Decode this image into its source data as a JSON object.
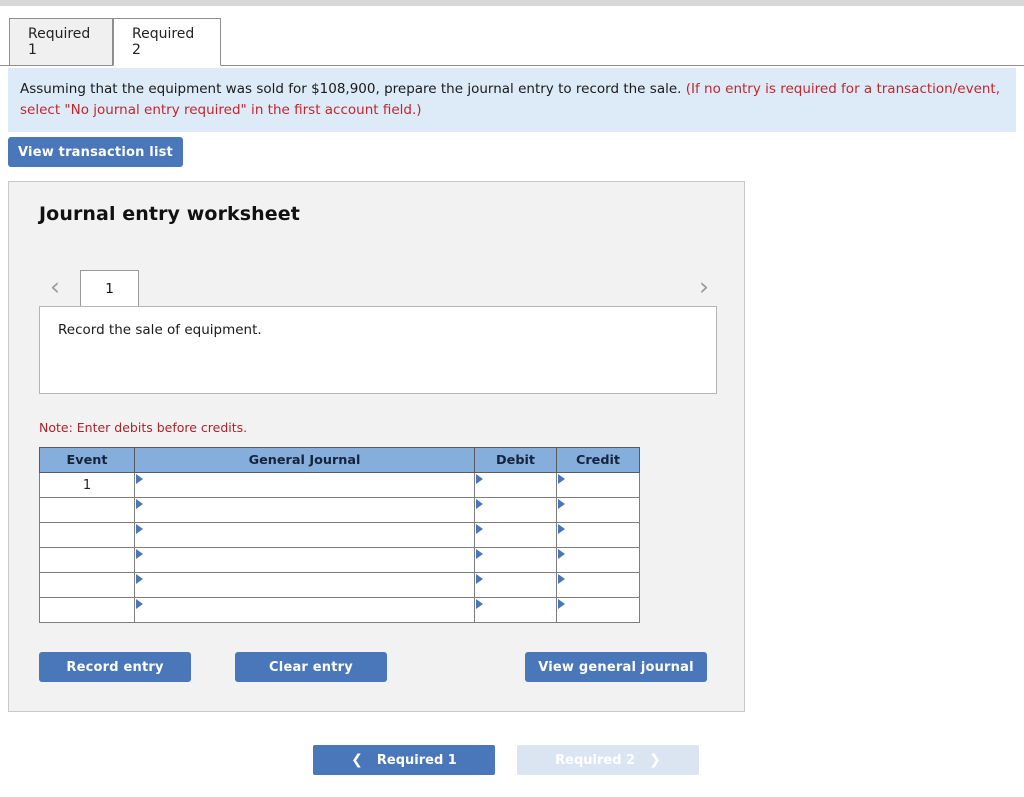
{
  "tabs": [
    {
      "label": "Required 1",
      "active": false
    },
    {
      "label": "Required 2",
      "active": true
    }
  ],
  "instructions": {
    "black_part": "Assuming that the equipment was sold for $108,900, prepare the journal entry to record the sale. ",
    "red_part": "(If no entry is required for a transaction/event, select \"No journal entry required\" in the first account field.)"
  },
  "toolbar": {
    "view_transaction_list_label": "View transaction list"
  },
  "worksheet": {
    "title": "Journal entry worksheet",
    "pager": {
      "prev_icon": "chevron-left-icon",
      "next_icon": "chevron-right-icon",
      "current_entry": "1"
    },
    "transaction_description": "Record the sale of equipment.",
    "note": "Note: Enter debits before credits.",
    "table": {
      "headers": [
        "Event",
        "General Journal",
        "Debit",
        "Credit"
      ],
      "rows": [
        {
          "event": "1",
          "general_journal": "",
          "debit": "",
          "credit": ""
        },
        {
          "event": "",
          "general_journal": "",
          "debit": "",
          "credit": ""
        },
        {
          "event": "",
          "general_journal": "",
          "debit": "",
          "credit": ""
        },
        {
          "event": "",
          "general_journal": "",
          "debit": "",
          "credit": ""
        },
        {
          "event": "",
          "general_journal": "",
          "debit": "",
          "credit": ""
        },
        {
          "event": "",
          "general_journal": "",
          "debit": "",
          "credit": ""
        }
      ]
    },
    "actions": {
      "record_entry_label": "Record entry",
      "clear_entry_label": "Clear entry",
      "view_general_journal_label": "View general journal"
    }
  },
  "bottom_nav": {
    "prev_label": "Required 1",
    "prev_icon": "chevron-left-icon",
    "next_label": "Required 2",
    "next_icon": "chevron-right-icon",
    "next_disabled": true
  },
  "colors": {
    "accent_blue": "#4a77ba",
    "table_header_blue": "#85aedd",
    "instruction_bg": "#dcebf7",
    "note_red": "#a8252b",
    "panel_bg": "#f2f2f2",
    "disabled_blue": "#dbe5f2"
  }
}
